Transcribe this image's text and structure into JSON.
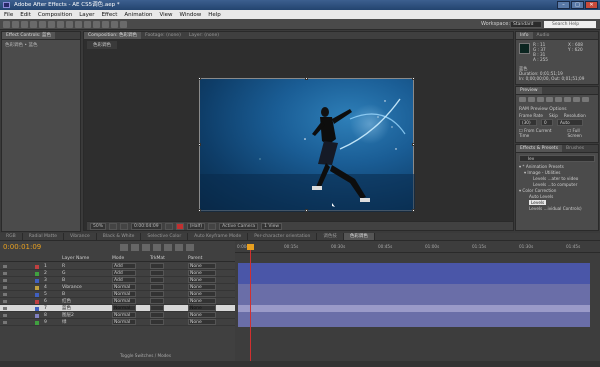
{
  "title": "Adobe After Effects - AE CS5调色.aep *",
  "window_buttons": [
    "–",
    "□",
    "✕"
  ],
  "menu": [
    "File",
    "Edit",
    "Composition",
    "Layer",
    "Effect",
    "Animation",
    "View",
    "Window",
    "Help"
  ],
  "toolbar": {
    "workspace_label": "Workspace:",
    "workspace_value": "Standard",
    "search_placeholder": "Search Help"
  },
  "project_panel": {
    "tab": "Effect Controls: 蓝色",
    "subtitle": "色彩调色 • 蓝色"
  },
  "composition_panel": {
    "tabs": [
      "Composition: 色彩调色",
      "Footage: (none)",
      "Layer: (none)"
    ],
    "comp_label": "色彩调色"
  },
  "comp_bottom_bar": {
    "zoom": "50%",
    "timecode": "0:00:04:09",
    "resolution": "(Half)",
    "camera": "Active Camera",
    "views": "1 View"
  },
  "info_panel": {
    "tabs": [
      "Info",
      "Audio"
    ],
    "r": "R : 11",
    "g": "G : 37",
    "b": "B : 31",
    "a": "A : 255",
    "x": "X : 608",
    "y": "Y : 620",
    "layer_name": "蓝色",
    "duration": "Duration: 0;01;51;19",
    "in_out": "In: 0;00;00;00, Out: 0;01;51;09"
  },
  "preview_panel": {
    "title": "Preview",
    "ram_options": "RAM Preview Options",
    "frame_rate_label": "Frame Rate",
    "skip_label": "Skip",
    "resolution_label": "Resolution",
    "frame_rate": "(30)",
    "skip": "0",
    "resolution": "Auto",
    "from_current": "From Current Time",
    "full_screen": "Full Screen"
  },
  "effects_panel": {
    "tabs": [
      "Effects & Presets",
      "Brushes"
    ],
    "search_value": "lev",
    "tree": [
      "▾ * Animation Presets",
      "▾ Image - Utilities",
      "Levels ...ater to video",
      "Levels ...to computer",
      "▾ Color Correction",
      "Auto Levels",
      "Levels",
      "Levels ...ividual Controls)"
    ]
  },
  "timeline": {
    "tabs": [
      "RGB",
      "Radial Matte",
      "Vibrance",
      "Black & White",
      "Selective Color",
      "Auto Keyframe Mode",
      "Per-character orientation",
      "调色技",
      "色彩调色"
    ],
    "timecode": "0:00:01:09",
    "columns": {
      "name": "Layer Name",
      "mode": "Mode",
      "trkmat": "TrkMat",
      "parent": "Parent"
    },
    "ruler": [
      "0:00s",
      "00:15s",
      "00:30s",
      "00:45s",
      "01:00s",
      "01:15s",
      "01:30s",
      "01:45s"
    ],
    "layers": [
      {
        "num": "1",
        "name": "R",
        "mode": "Add",
        "trk": "",
        "parent": "None",
        "color": "#c04040"
      },
      {
        "num": "2",
        "name": "G",
        "mode": "Add",
        "trk": "None",
        "parent": "None",
        "color": "#40a040"
      },
      {
        "num": "3",
        "name": "B",
        "mode": "Add",
        "trk": "None",
        "parent": "None",
        "color": "#4060c0"
      },
      {
        "num": "4",
        "name": "Vibrance",
        "mode": "Normal",
        "trk": "None",
        "parent": "None",
        "color": "#c0a040"
      },
      {
        "num": "5",
        "name": "B",
        "mode": "Normal",
        "trk": "None",
        "parent": "None",
        "color": "#4060c0"
      },
      {
        "num": "6",
        "name": "红色",
        "mode": "Normal",
        "trk": "None",
        "parent": "None",
        "color": "#c04040"
      },
      {
        "num": "7",
        "name": "蓝色",
        "mode": "Normal",
        "trk": "None",
        "parent": "None",
        "color": "#4060c0"
      },
      {
        "num": "8",
        "name": "图层2",
        "mode": "Normal",
        "trk": "None",
        "parent": "None",
        "color": "#8080c0"
      },
      {
        "num": "9",
        "name": "绿",
        "mode": "Normal",
        "trk": "None",
        "parent": "None",
        "color": "#40a040"
      }
    ],
    "toggle_label": "Toggle Switches / Modes"
  },
  "colors": {
    "accent_orange": "#e8a020",
    "bar_blue": "#4a56a8",
    "bar_selected": "#9a9ac8"
  }
}
